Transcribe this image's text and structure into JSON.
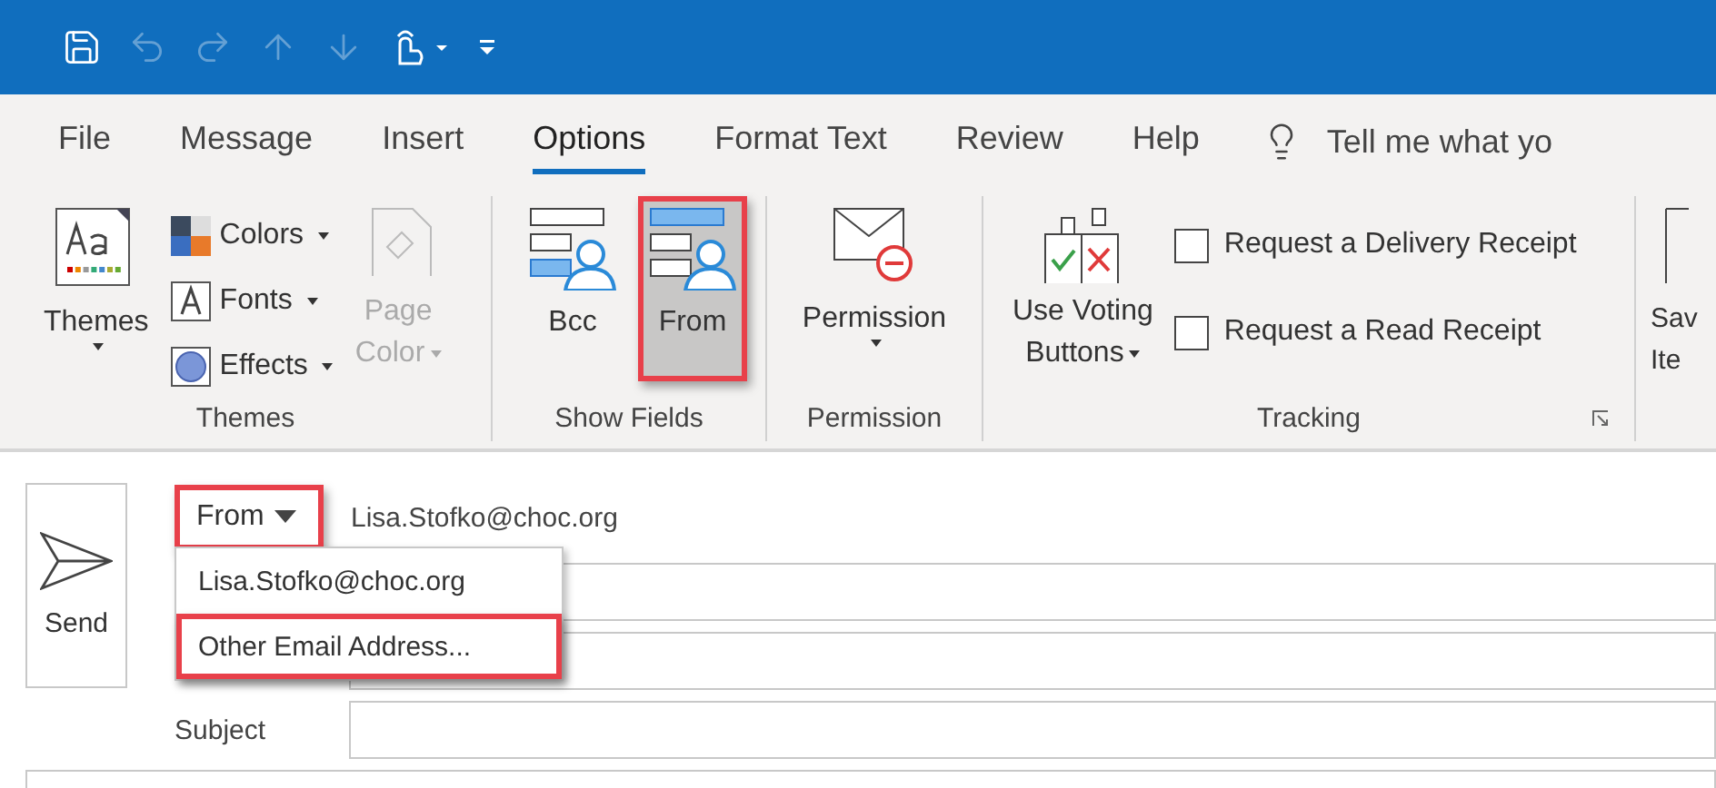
{
  "quick_access": [
    {
      "kind": "save",
      "disabled": false
    },
    {
      "kind": "undo",
      "disabled": true
    },
    {
      "kind": "redo",
      "disabled": true
    },
    {
      "kind": "up",
      "disabled": true
    },
    {
      "kind": "down",
      "disabled": true
    },
    {
      "kind": "touch",
      "disabled": false
    },
    {
      "kind": "customize",
      "disabled": false
    }
  ],
  "tabs": [
    {
      "label": "File",
      "selected": false
    },
    {
      "label": "Message",
      "selected": false
    },
    {
      "label": "Insert",
      "selected": false
    },
    {
      "label": "Options",
      "selected": true
    },
    {
      "label": "Format Text",
      "selected": false
    },
    {
      "label": "Review",
      "selected": false
    },
    {
      "label": "Help",
      "selected": false
    }
  ],
  "tell_me": "Tell me what yo",
  "themes_group": {
    "label": "Themes",
    "themes_button": "Themes",
    "options": [
      {
        "kind": "colors",
        "label": "Colors"
      },
      {
        "kind": "fonts",
        "label": "Fonts"
      },
      {
        "kind": "effects",
        "label": "Effects"
      }
    ],
    "page_color": {
      "lines": [
        "Page",
        "Color"
      ],
      "disabled": true
    }
  },
  "show_fields_group": {
    "label": "Show Fields",
    "buttons": [
      {
        "kind": "bcc",
        "label": "Bcc",
        "selected": false,
        "highlighted": false
      },
      {
        "kind": "from",
        "label": "From",
        "selected": true,
        "highlighted": true
      }
    ]
  },
  "permission_group": {
    "label": "Permission",
    "button": "Permission"
  },
  "tracking_group": {
    "label": "Tracking",
    "voting": {
      "lines": [
        "Use Voting",
        "Buttons"
      ]
    },
    "checkboxes": [
      {
        "label": "Request a Delivery Receipt",
        "checked": false
      },
      {
        "label": "Request a Read Receipt",
        "checked": false
      }
    ]
  },
  "save_items": {
    "lines": [
      "Sav",
      "Ite"
    ]
  },
  "compose": {
    "send": "Send",
    "from_button": {
      "label": "From",
      "highlighted": true
    },
    "from_address": "Lisa.Stofko@choc.org",
    "subject_label": "Subject",
    "from_menu": [
      {
        "label": "Lisa.Stofko@choc.org",
        "highlighted": false
      },
      {
        "label": "Other Email Address...",
        "highlighted": true
      }
    ]
  }
}
